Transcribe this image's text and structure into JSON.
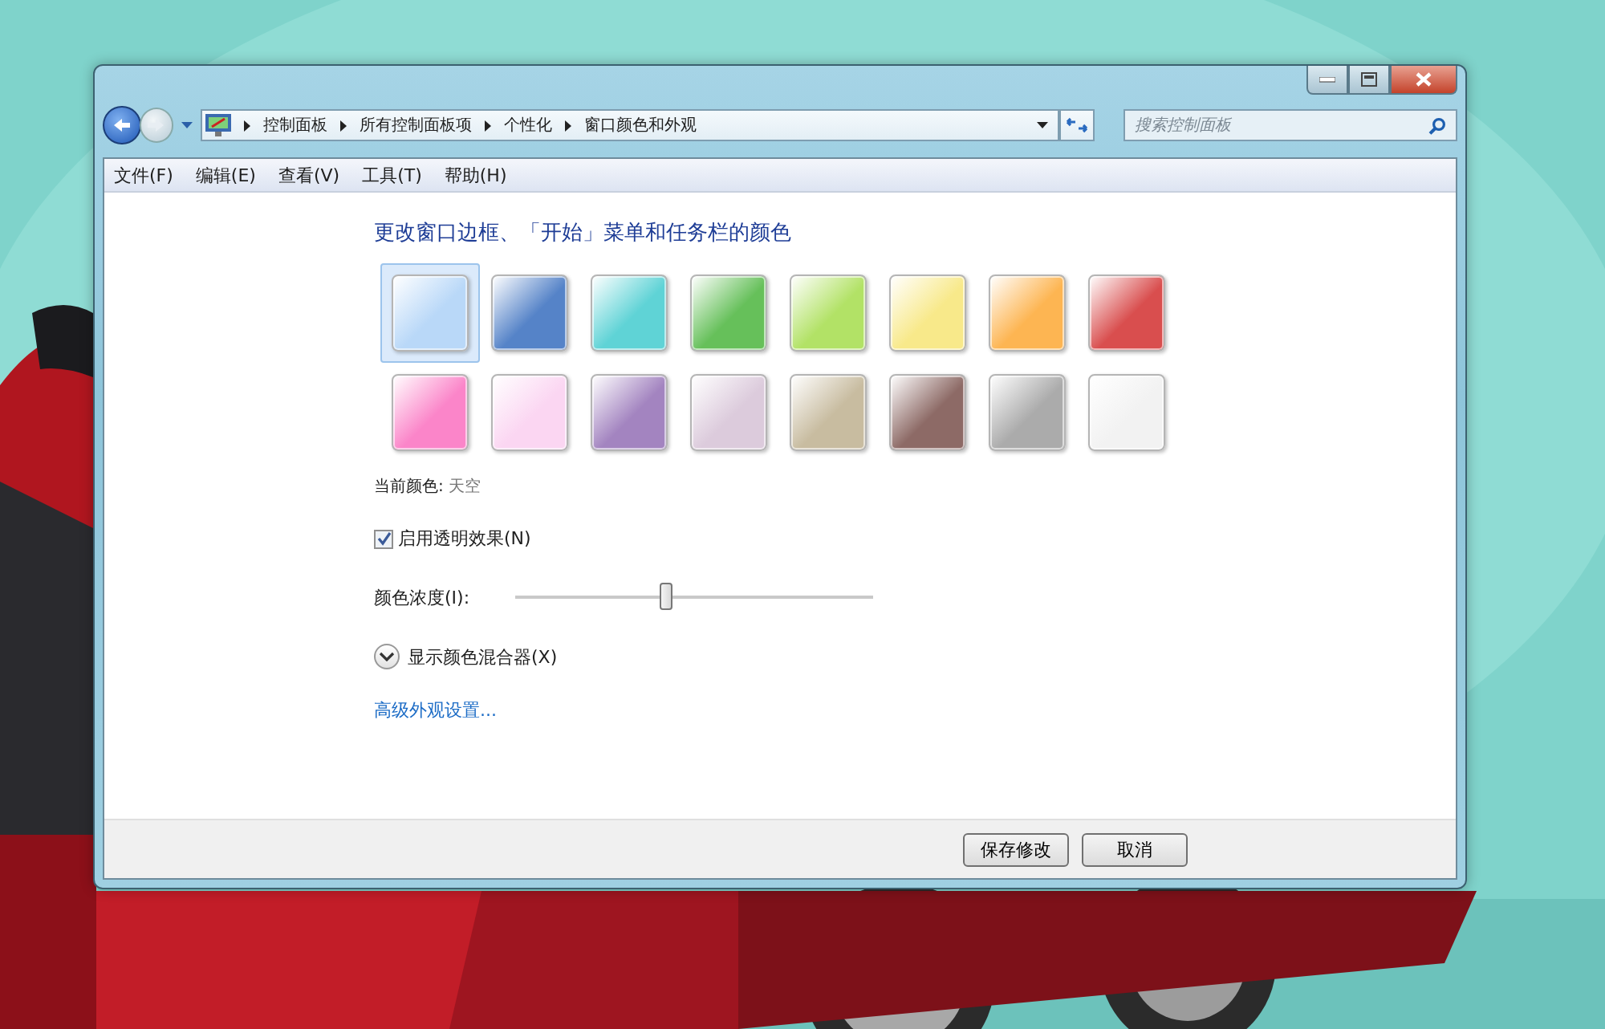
{
  "address_bar": {
    "breadcrumbs": [
      "控制面板",
      "所有控制面板项",
      "个性化",
      "窗口颜色和外观"
    ]
  },
  "search": {
    "placeholder": "搜索控制面板"
  },
  "menu_bar": [
    "文件(F)",
    "编辑(E)",
    "查看(V)",
    "工具(T)",
    "帮助(H)"
  ],
  "heading": "更改窗口边框、「开始」菜单和任务栏的颜色",
  "swatches": [
    {
      "color": "#b9d8f8",
      "selected": true
    },
    {
      "color": "#5583c8",
      "selected": false
    },
    {
      "color": "#5fd3d6",
      "selected": false
    },
    {
      "color": "#66c05a",
      "selected": false
    },
    {
      "color": "#b2e266",
      "selected": false
    },
    {
      "color": "#f8e98a",
      "selected": false
    },
    {
      "color": "#fdb552",
      "selected": false
    },
    {
      "color": "#d94e4e",
      "selected": false
    },
    {
      "color": "#fb85c9",
      "selected": false
    },
    {
      "color": "#fbd6f2",
      "selected": false
    },
    {
      "color": "#a384c0",
      "selected": false
    },
    {
      "color": "#dccbdc",
      "selected": false
    },
    {
      "color": "#c8bca0",
      "selected": false
    },
    {
      "color": "#8d6a66",
      "selected": false
    },
    {
      "color": "#ababab",
      "selected": false
    },
    {
      "color": "#f2f2f2",
      "selected": false
    }
  ],
  "current_color": {
    "label": "当前颜色:",
    "value": "天空"
  },
  "transparency": {
    "label": "启用透明效果(N)",
    "checked": true
  },
  "intensity": {
    "label": "颜色浓度(I):",
    "level": 0.42
  },
  "mixer": {
    "label": "显示颜色混合器(X)",
    "expanded": false
  },
  "advanced_link": "高级外观设置...",
  "buttons": [
    "保存修改",
    "取消"
  ]
}
